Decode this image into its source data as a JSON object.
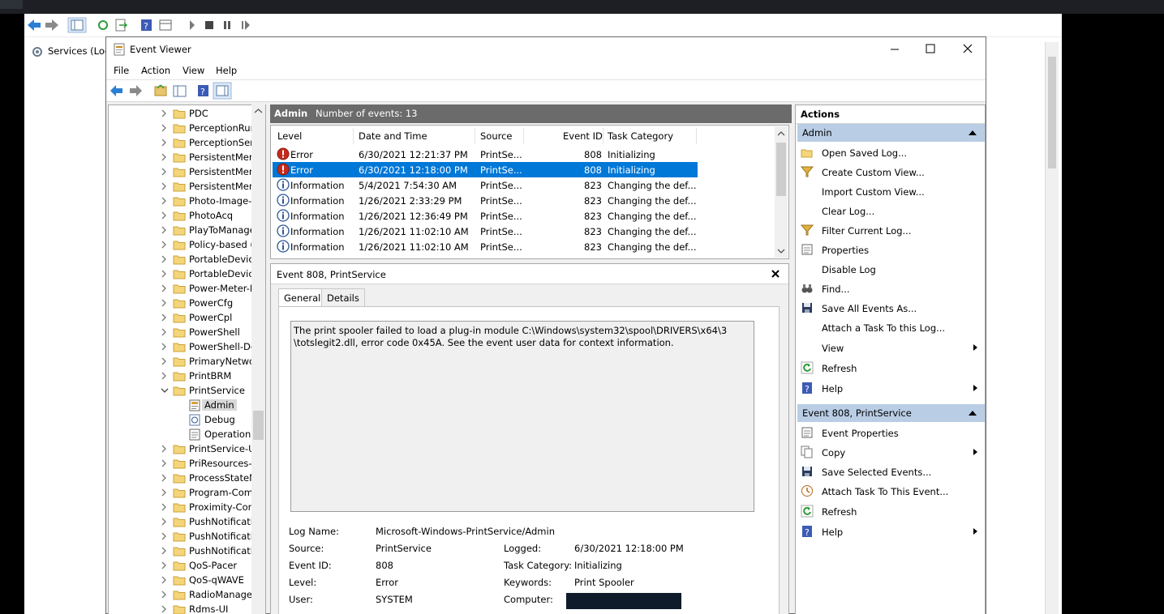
{
  "background": {
    "sidebar_label": "Services (Loca"
  },
  "window": {
    "title": "Event Viewer",
    "menu": [
      "File",
      "Action",
      "View",
      "Help"
    ]
  },
  "tree": {
    "items": [
      {
        "label": "PDC",
        "expanded": false
      },
      {
        "label": "PerceptionRur",
        "expanded": false
      },
      {
        "label": "PerceptionSen",
        "expanded": false
      },
      {
        "label": "PersistentMem",
        "expanded": false
      },
      {
        "label": "PersistentMem",
        "expanded": false
      },
      {
        "label": "PersistentMem",
        "expanded": false
      },
      {
        "label": "Photo-Image-",
        "expanded": false
      },
      {
        "label": "PhotoAcq",
        "expanded": false
      },
      {
        "label": "PlayToManage",
        "expanded": false
      },
      {
        "label": "Policy-based (",
        "expanded": false
      },
      {
        "label": "PortableDevice",
        "expanded": false
      },
      {
        "label": "PortableDevice",
        "expanded": false
      },
      {
        "label": "Power-Meter-I",
        "expanded": false
      },
      {
        "label": "PowerCfg",
        "expanded": false
      },
      {
        "label": "PowerCpl",
        "expanded": false
      },
      {
        "label": "PowerShell",
        "expanded": false
      },
      {
        "label": "PowerShell-De",
        "expanded": false
      },
      {
        "label": "PrimaryNetwo",
        "expanded": false
      },
      {
        "label": "PrintBRM",
        "expanded": false
      },
      {
        "label": "PrintService",
        "expanded": true
      },
      {
        "label": "Admin",
        "child": true,
        "selected": true,
        "icon": "admin-log-icon"
      },
      {
        "label": "Debug",
        "child": true,
        "icon": "debug-log-icon"
      },
      {
        "label": "Operationa",
        "child": true,
        "icon": "operational-log-icon"
      },
      {
        "label": "PrintService-U",
        "expanded": false
      },
      {
        "label": "PriResources-E",
        "expanded": false
      },
      {
        "label": "ProcessStateM",
        "expanded": false
      },
      {
        "label": "Program-Com",
        "expanded": false
      },
      {
        "label": "Proximity-Con",
        "expanded": false
      },
      {
        "label": "PushNotificati",
        "expanded": false
      },
      {
        "label": "PushNotificati",
        "expanded": false
      },
      {
        "label": "PushNotificati",
        "expanded": false
      },
      {
        "label": "QoS-Pacer",
        "expanded": false
      },
      {
        "label": "QoS-qWAVE",
        "expanded": false
      },
      {
        "label": "RadioManager",
        "expanded": false
      },
      {
        "label": "Rdms-UI",
        "expanded": false
      }
    ]
  },
  "center": {
    "log_name": "Admin",
    "count_label": "Number of events: 13"
  },
  "event_list": {
    "columns": [
      "Level",
      "Date and Time",
      "Source",
      "Event ID",
      "Task Category"
    ],
    "rows": [
      {
        "level": "Error",
        "date": "6/30/2021 12:21:37 PM",
        "source": "PrintSe...",
        "id": "808",
        "category": "Initializing",
        "icon": "error-icon"
      },
      {
        "level": "Error",
        "date": "6/30/2021 12:18:00 PM",
        "source": "PrintSe...",
        "id": "808",
        "category": "Initializing",
        "icon": "error-icon",
        "selected": true
      },
      {
        "level": "Information",
        "date": "5/4/2021 7:54:30 AM",
        "source": "PrintSe...",
        "id": "823",
        "category": "Changing the def...",
        "icon": "info-icon"
      },
      {
        "level": "Information",
        "date": "1/26/2021 2:33:29 PM",
        "source": "PrintSe...",
        "id": "823",
        "category": "Changing the def...",
        "icon": "info-icon"
      },
      {
        "level": "Information",
        "date": "1/26/2021 12:36:49 PM",
        "source": "PrintSe...",
        "id": "823",
        "category": "Changing the def...",
        "icon": "info-icon"
      },
      {
        "level": "Information",
        "date": "1/26/2021 11:02:10 AM",
        "source": "PrintSe...",
        "id": "823",
        "category": "Changing the def...",
        "icon": "info-icon"
      },
      {
        "level": "Information",
        "date": "1/26/2021 11:02:10 AM",
        "source": "PrintSe...",
        "id": "823",
        "category": "Changing the def...",
        "icon": "info-icon"
      }
    ]
  },
  "detail": {
    "title": "Event 808, PrintService",
    "tabs": [
      "General",
      "Details"
    ],
    "description": "The print spooler failed to load a plug-in module C:\\Windows\\system32\\spool\\DRIVERS\\x64\\3 \\totslegit2.dll, error code 0x45A. See the event user data for context information.",
    "fields": {
      "log_name_label": "Log Name:",
      "log_name": "Microsoft-Windows-PrintService/Admin",
      "source_label": "Source:",
      "source": "PrintService",
      "logged_label": "Logged:",
      "logged": "6/30/2021 12:18:00 PM",
      "event_id_label": "Event ID:",
      "event_id": "808",
      "task_category_label": "Task Category:",
      "task_category": "Initializing",
      "level_label": "Level:",
      "level": "Error",
      "keywords_label": "Keywords:",
      "keywords": "Print Spooler",
      "user_label": "User:",
      "user": "SYSTEM",
      "computer_label": "Computer:"
    }
  },
  "actions": {
    "header": "Actions",
    "section1": {
      "title": "Admin",
      "items": [
        {
          "label": "Open Saved Log...",
          "icon": "open-folder-icon"
        },
        {
          "label": "Create Custom View...",
          "icon": "filter-icon"
        },
        {
          "label": "Import Custom View...",
          "icon": ""
        },
        {
          "label": "Clear Log...",
          "icon": ""
        },
        {
          "label": "Filter Current Log...",
          "icon": "filter-icon"
        },
        {
          "label": "Properties",
          "icon": "properties-icon"
        },
        {
          "label": "Disable Log",
          "icon": ""
        },
        {
          "label": "Find...",
          "icon": "binoculars-icon"
        },
        {
          "label": "Save All Events As...",
          "icon": "save-icon"
        },
        {
          "label": "Attach a Task To this Log...",
          "icon": ""
        },
        {
          "label": "View",
          "icon": "",
          "submenu": true
        },
        {
          "label": "Refresh",
          "icon": "refresh-icon"
        },
        {
          "label": "Help",
          "icon": "help-icon",
          "submenu": true
        }
      ]
    },
    "section2": {
      "title": "Event 808, PrintService",
      "items": [
        {
          "label": "Event Properties",
          "icon": "properties-icon"
        },
        {
          "label": "Copy",
          "icon": "copy-icon",
          "submenu": true
        },
        {
          "label": "Save Selected Events...",
          "icon": "save-icon"
        },
        {
          "label": "Attach Task To This Event...",
          "icon": "task-icon"
        },
        {
          "label": "Refresh",
          "icon": "refresh-icon"
        },
        {
          "label": "Help",
          "icon": "help-icon",
          "submenu": true
        }
      ]
    }
  },
  "colors": {
    "selection": "#0078d7",
    "section_header": "#b9cde5",
    "center_header": "#6b6b6b",
    "error": "#c42b1c",
    "info": "#2b5797"
  }
}
